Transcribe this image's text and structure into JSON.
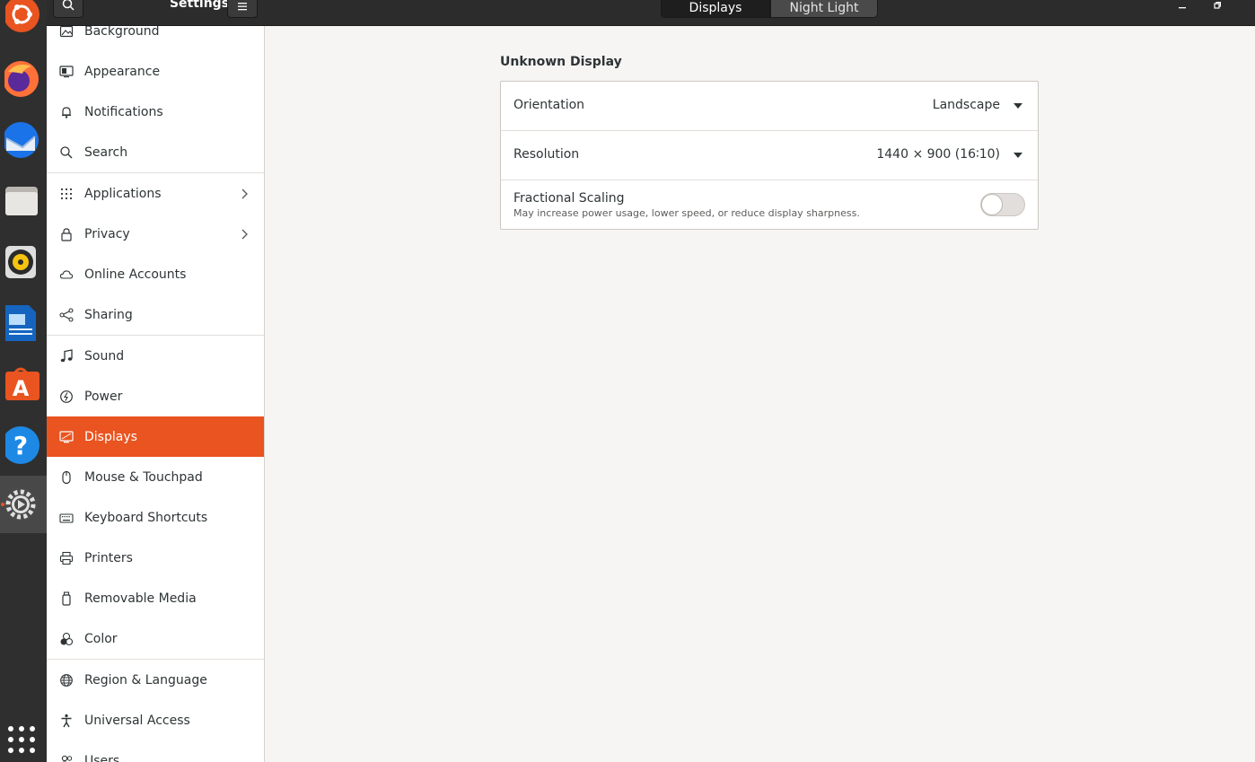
{
  "app": {
    "title": "Settings"
  },
  "header": {
    "tabs": [
      {
        "label": "Displays",
        "selected": true
      },
      {
        "label": "Night Light",
        "selected": false
      }
    ]
  },
  "dock": {
    "apps": [
      "ubuntu-icon",
      "firefox-icon",
      "thunderbird-icon",
      "files-icon",
      "rhythmbox-icon",
      "libreoffice-writer-icon",
      "software-center-icon",
      "help-icon",
      "settings-icon",
      "show-apps-icon"
    ],
    "active": "settings-icon"
  },
  "sidebar": {
    "items": [
      {
        "label": "Background",
        "icon": "background-icon"
      },
      {
        "label": "Appearance",
        "icon": "appearance-icon"
      },
      {
        "label": "Notifications",
        "icon": "bell-icon"
      },
      {
        "label": "Search",
        "icon": "search-icon"
      },
      {
        "label": "Applications",
        "icon": "grid-icon",
        "has_submenu": true
      },
      {
        "label": "Privacy",
        "icon": "lock-icon",
        "has_submenu": true
      },
      {
        "label": "Online Accounts",
        "icon": "cloud-icon"
      },
      {
        "label": "Sharing",
        "icon": "share-icon"
      },
      {
        "label": "Sound",
        "icon": "music-note-icon"
      },
      {
        "label": "Power",
        "icon": "power-icon"
      },
      {
        "label": "Displays",
        "icon": "display-icon",
        "selected": true
      },
      {
        "label": "Mouse & Touchpad",
        "icon": "mouse-icon"
      },
      {
        "label": "Keyboard Shortcuts",
        "icon": "keyboard-icon"
      },
      {
        "label": "Printers",
        "icon": "printer-icon"
      },
      {
        "label": "Removable Media",
        "icon": "usb-drive-icon"
      },
      {
        "label": "Color",
        "icon": "color-icon"
      },
      {
        "label": "Region & Language",
        "icon": "globe-icon"
      },
      {
        "label": "Universal Access",
        "icon": "accessibility-icon"
      },
      {
        "label": "Users",
        "icon": "users-icon"
      }
    ]
  },
  "main": {
    "section_title": "Unknown Display",
    "orientation": {
      "label": "Orientation",
      "value": "Landscape"
    },
    "resolution": {
      "label": "Resolution",
      "value": "1440 × 900 (16∶10)"
    },
    "fractional_scaling": {
      "label": "Fractional Scaling",
      "description": "May increase power usage, lower speed, or reduce display sharpness.",
      "enabled": false
    }
  },
  "colors": {
    "accent": "#e95420",
    "headerbar": "#2c2c2c",
    "dock": "#2f2f2f"
  }
}
